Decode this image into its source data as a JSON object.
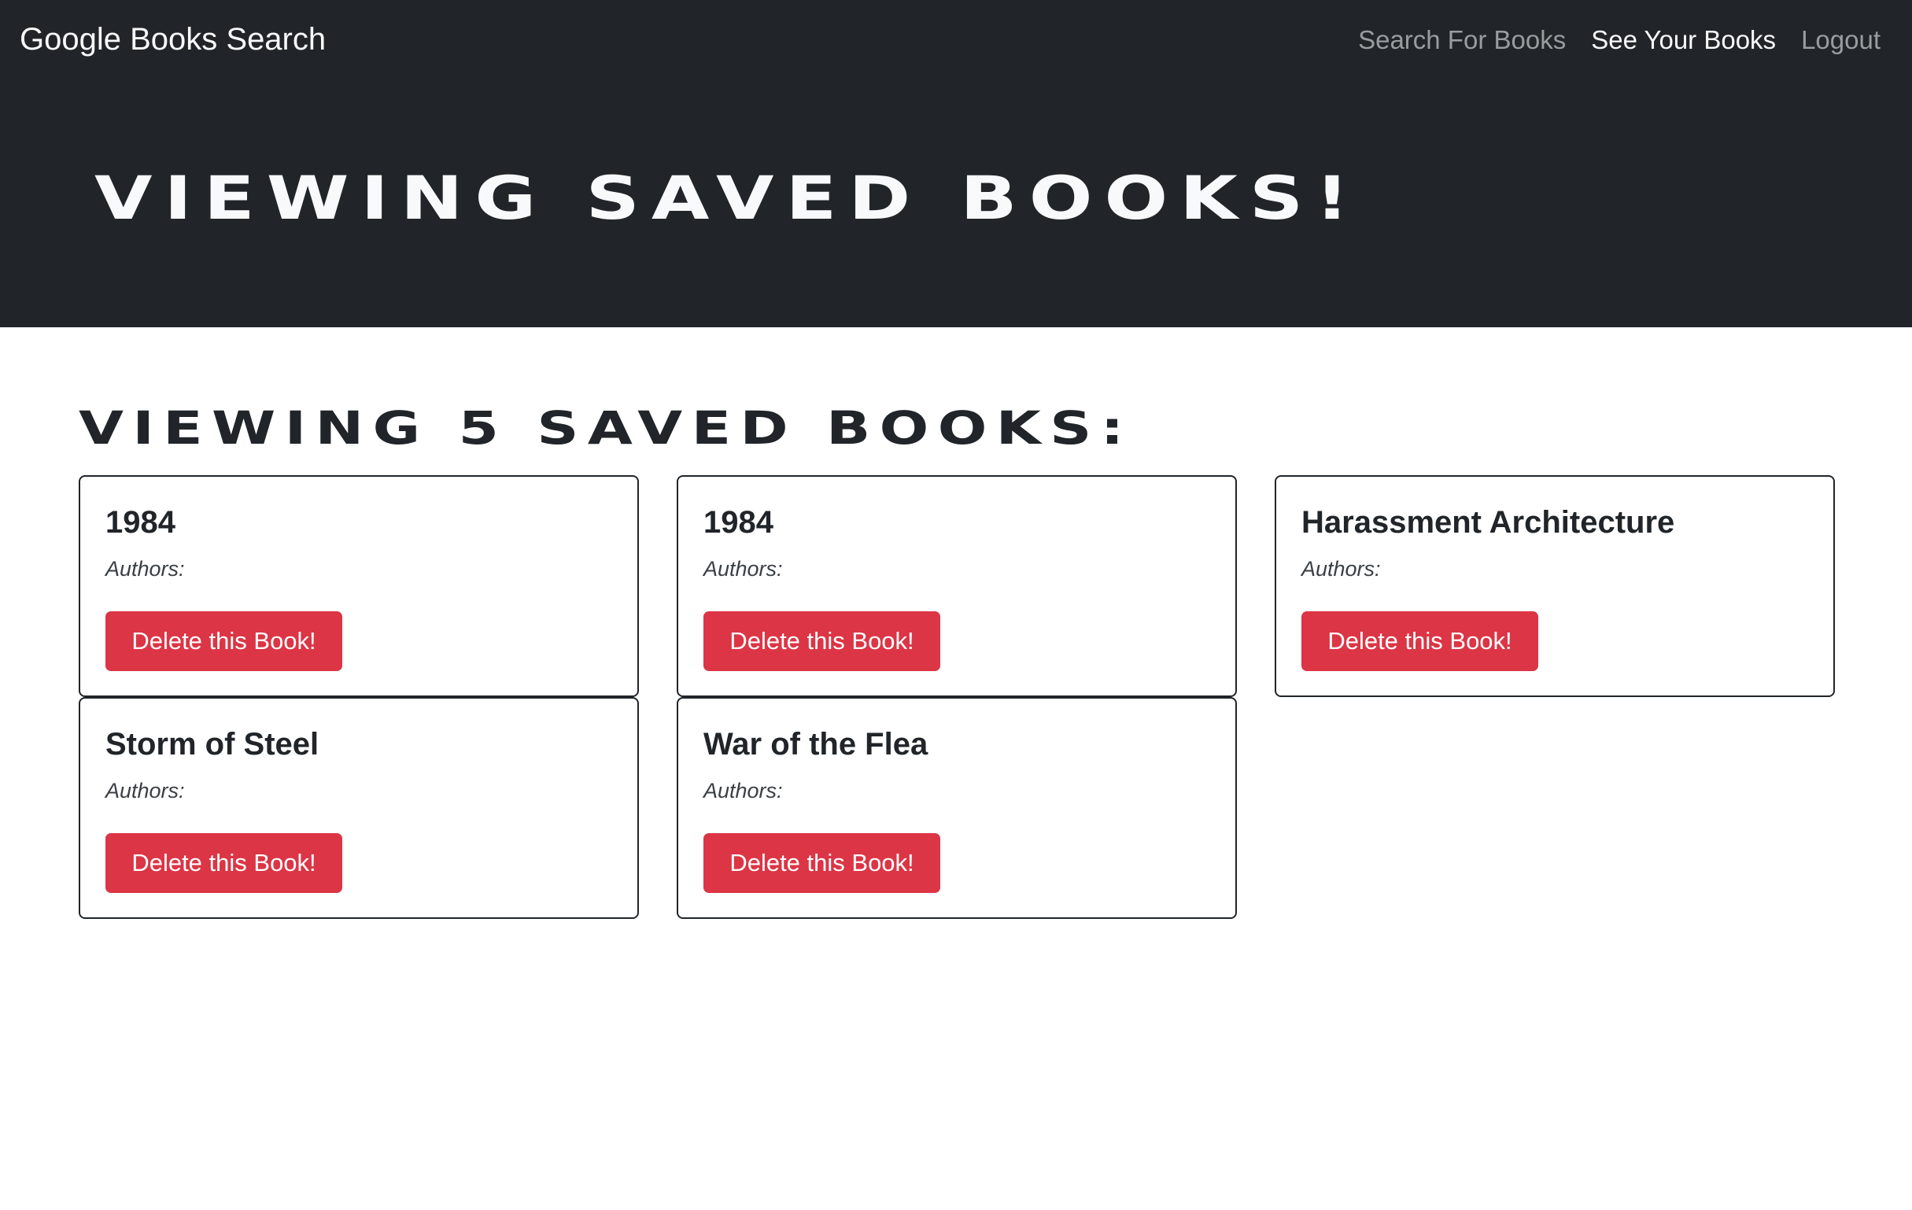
{
  "navbar": {
    "brand": "Google Books Search",
    "links": [
      {
        "label": "Search For Books",
        "active": false
      },
      {
        "label": "See Your Books",
        "active": true
      },
      {
        "label": "Logout",
        "active": false
      }
    ]
  },
  "hero": {
    "title": "Viewing saved books!"
  },
  "main": {
    "results_heading": "Viewing 5 saved books:",
    "books": [
      {
        "title": "1984",
        "authors_label": "Authors:",
        "delete_label": "Delete this Book!"
      },
      {
        "title": "1984",
        "authors_label": "Authors:",
        "delete_label": "Delete this Book!"
      },
      {
        "title": "Harassment Architecture",
        "authors_label": "Authors:",
        "delete_label": "Delete this Book!"
      },
      {
        "title": "Storm of Steel",
        "authors_label": "Authors:",
        "delete_label": "Delete this Book!"
      },
      {
        "title": "War of the Flea",
        "authors_label": "Authors:",
        "delete_label": "Delete this Book!"
      }
    ]
  },
  "colors": {
    "navbar_bg": "#212529",
    "danger": "#dc3545",
    "nav_link_muted": "#9a9da0",
    "nav_link_active": "#f8f9fa"
  }
}
